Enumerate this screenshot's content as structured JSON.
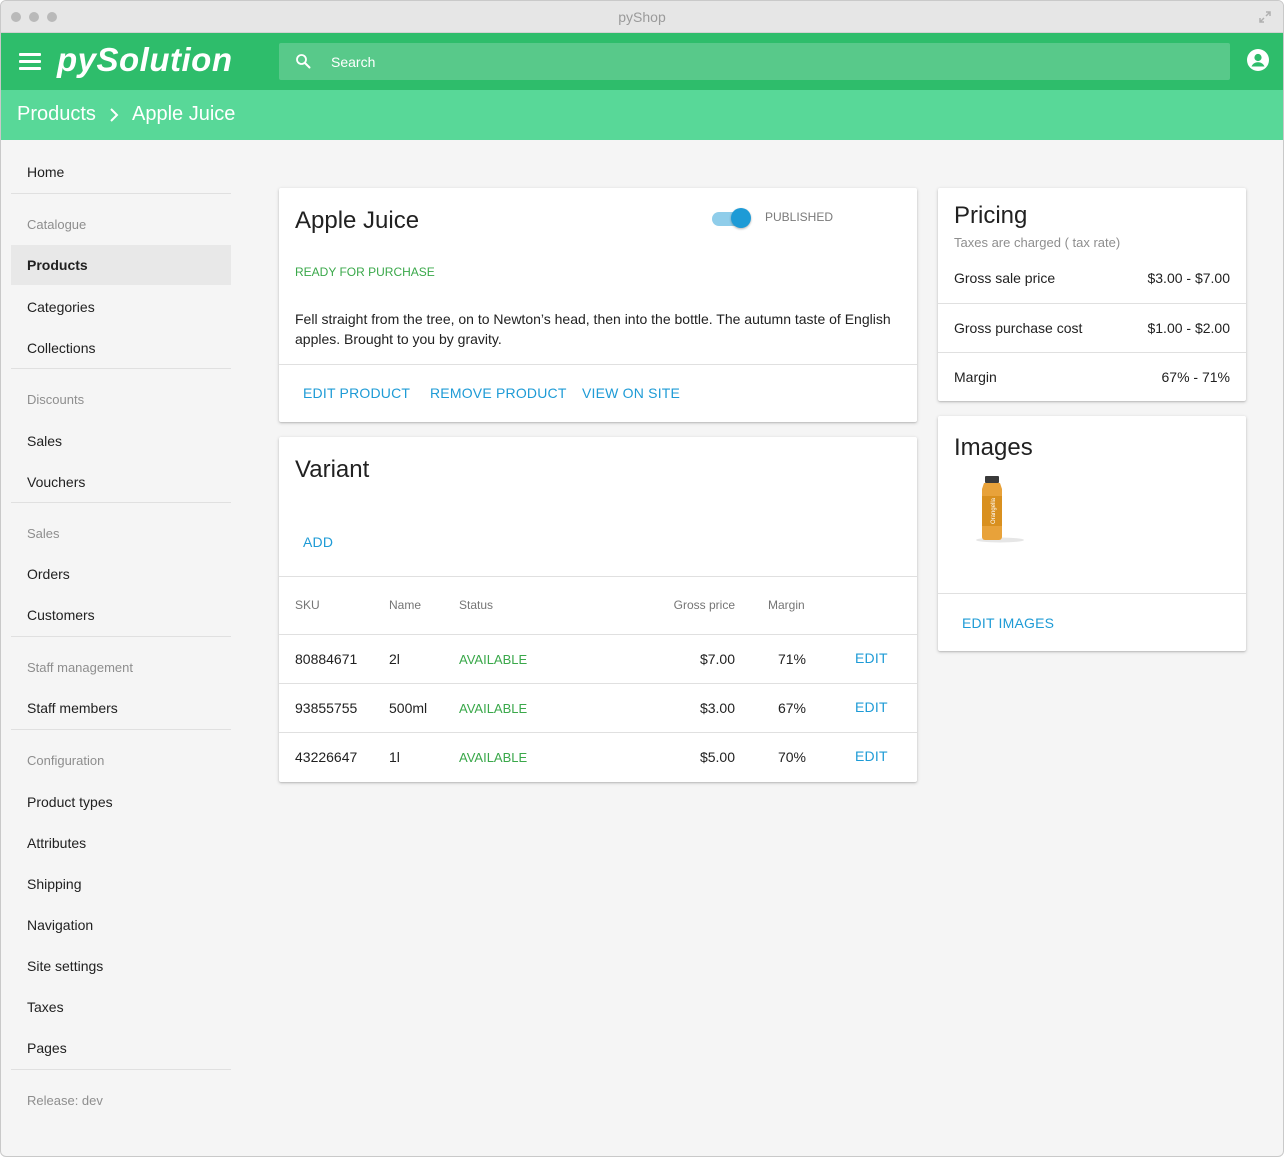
{
  "window": {
    "title": "pyShop"
  },
  "appbar": {
    "logo": "pySolution",
    "search_placeholder": "Search"
  },
  "breadcrumb": {
    "parent": "Products",
    "current": "Apple Juice"
  },
  "sidebar": {
    "items": [
      {
        "label": "Home"
      },
      {
        "section": "Catalogue"
      },
      {
        "label": "Products",
        "active": true
      },
      {
        "label": "Categories"
      },
      {
        "label": "Collections"
      },
      {
        "section": "Discounts"
      },
      {
        "label": "Sales"
      },
      {
        "label": "Vouchers"
      },
      {
        "section": "Sales"
      },
      {
        "label": "Orders"
      },
      {
        "label": "Customers"
      },
      {
        "section": "Staff management"
      },
      {
        "label": "Staff members"
      },
      {
        "section": "Configuration"
      },
      {
        "label": "Product types"
      },
      {
        "label": "Attributes"
      },
      {
        "label": "Shipping"
      },
      {
        "label": "Navigation"
      },
      {
        "label": "Site settings"
      },
      {
        "label": "Taxes"
      },
      {
        "label": "Pages"
      }
    ],
    "release": "Release: dev"
  },
  "product": {
    "name": "Apple Juice",
    "published_label": "PUBLISHED",
    "published": true,
    "availability": "READY FOR PURCHASE",
    "description": "Fell straight from the tree, on to Newton’s head, then into the bottle. The autumn taste of English apples. Brought to you by gravity.",
    "actions": {
      "edit": "EDIT PRODUCT",
      "remove": "REMOVE PRODUCT",
      "view": "VIEW ON SITE"
    }
  },
  "variants": {
    "title": "Variant",
    "add_label": "ADD",
    "columns": {
      "sku": "SKU",
      "name": "Name",
      "status": "Status",
      "price": "Gross price",
      "margin": "Margin"
    },
    "rows": [
      {
        "sku": "80884671",
        "name": "2l",
        "status": "AVAILABLE",
        "price": "$7.00",
        "margin": "71%",
        "edit": "EDIT"
      },
      {
        "sku": "93855755",
        "name": "500ml",
        "status": "AVAILABLE",
        "price": "$3.00",
        "margin": "67%",
        "edit": "EDIT"
      },
      {
        "sku": "43226647",
        "name": "1l",
        "status": "AVAILABLE",
        "price": "$5.00",
        "margin": "70%",
        "edit": "EDIT"
      }
    ]
  },
  "pricing": {
    "title": "Pricing",
    "subtitle": "Taxes are charged ( tax rate)",
    "rows": [
      {
        "label": "Gross sale price",
        "value": "$3.00 - $7.00"
      },
      {
        "label": "Gross purchase cost",
        "value": "$1.00 - $2.00"
      },
      {
        "label": "Margin",
        "value": "67% - 71%"
      }
    ]
  },
  "images": {
    "title": "Images",
    "edit_label": "EDIT IMAGES",
    "product_image": "orange-juice-bottle",
    "bottle_label": "Orangella"
  },
  "colors": {
    "appbar": "#2ebd6b",
    "breadcrumb": "#58d898",
    "link": "#1e9bd6",
    "status": "#3aa84a"
  }
}
